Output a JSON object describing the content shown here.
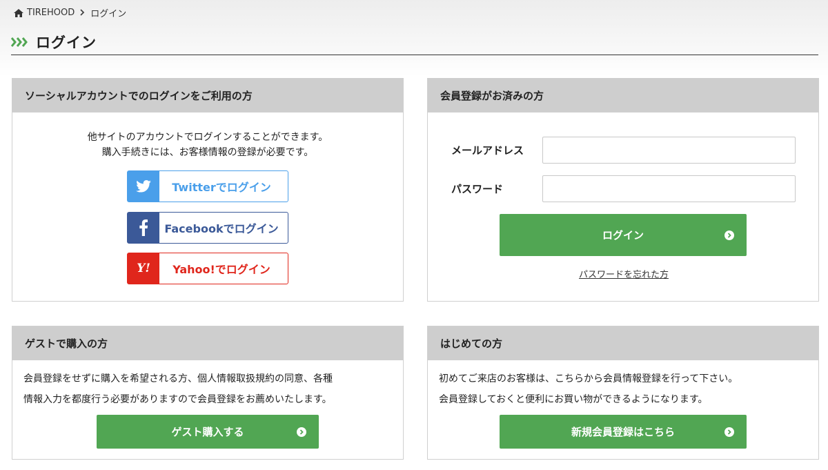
{
  "breadcrumb": {
    "home": "TIREHOOD",
    "current": "ログイン"
  },
  "page_title": "ログイン",
  "social": {
    "heading": "ソーシャルアカウントでのログインをご利用の方",
    "intro_line1": "他サイトのアカウントでログインすることができます。",
    "intro_line2": "購入手続きには、お客様情報の登録が必要です。",
    "twitter_label": "Twitterでログイン",
    "facebook_label": "Facebookでログイン",
    "yahoo_label": "Yahoo!でログイン",
    "yahoo_logo": "Y!"
  },
  "member": {
    "heading": "会員登録がお済みの方",
    "email_label": "メールアドレス",
    "email_value": "",
    "password_label": "パスワード",
    "password_value": "",
    "login_button": "ログイン",
    "forgot_link": "パスワードを忘れた方"
  },
  "guest": {
    "heading": "ゲストで購入の方",
    "text_line1": "会員登録をせずに購入を希望される方、個人情報取扱規約の同意、各種",
    "text_line2": "情報入力を都度行う必要がありますので会員登録をお薦めいたします。",
    "button": "ゲスト購入する"
  },
  "first_time": {
    "heading": "はじめての方",
    "text_line1": "初めてご来店のお客様は、こちらから会員情報登録を行って下さい。",
    "text_line2": "会員登録しておくと便利にお買い物ができるようになります。",
    "button": "新規会員登録はこちら"
  },
  "colors": {
    "accent_green": "#51a653",
    "twitter": "#4a9fea",
    "facebook": "#3b5998",
    "yahoo": "#e0261c",
    "panel_header": "#cecece"
  },
  "icons": {
    "home": "home-icon",
    "breadcrumb_separator": "chevron-right-icon",
    "title_marker": "triple-chevron-icon",
    "twitter": "twitter-bird-icon",
    "facebook": "facebook-f-icon",
    "yahoo": "yahoo-logo-icon",
    "button_arrow": "circle-chevron-right-icon"
  }
}
